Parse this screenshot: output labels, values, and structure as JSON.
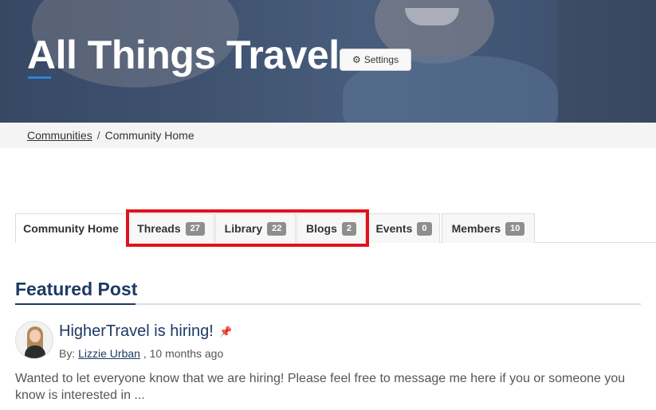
{
  "hero": {
    "title": "All Things Travel",
    "settings_label": "Settings",
    "settings_icon": "gear-icon"
  },
  "breadcrumb": {
    "items": [
      "Communities",
      "Community Home"
    ],
    "separator": "/"
  },
  "tabs": [
    {
      "label": "Community Home",
      "count": null,
      "active": true
    },
    {
      "label": "Threads",
      "count": "27",
      "active": false
    },
    {
      "label": "Library",
      "count": "22",
      "active": false
    },
    {
      "label": "Blogs",
      "count": "2",
      "active": false
    },
    {
      "label": "Events",
      "count": "0",
      "active": false
    },
    {
      "label": "Members",
      "count": "10",
      "active": false
    }
  ],
  "featured": {
    "heading": "Featured Post",
    "post": {
      "title": "HigherTravel is hiring!",
      "pin_icon": "pin-icon",
      "by_label": "By:",
      "author": "Lizzie Urban",
      "time_suffix": ", 10 months ago",
      "body": "Wanted to let everyone know that we are hiring! Please feel free to message me here if you or someone you know is interested in ..."
    }
  },
  "colors": {
    "heading_navy": "#1d3a63",
    "highlight_red": "#e2121b",
    "accent_blue": "#2f83d6",
    "badge_gray": "#8e8e8e"
  }
}
